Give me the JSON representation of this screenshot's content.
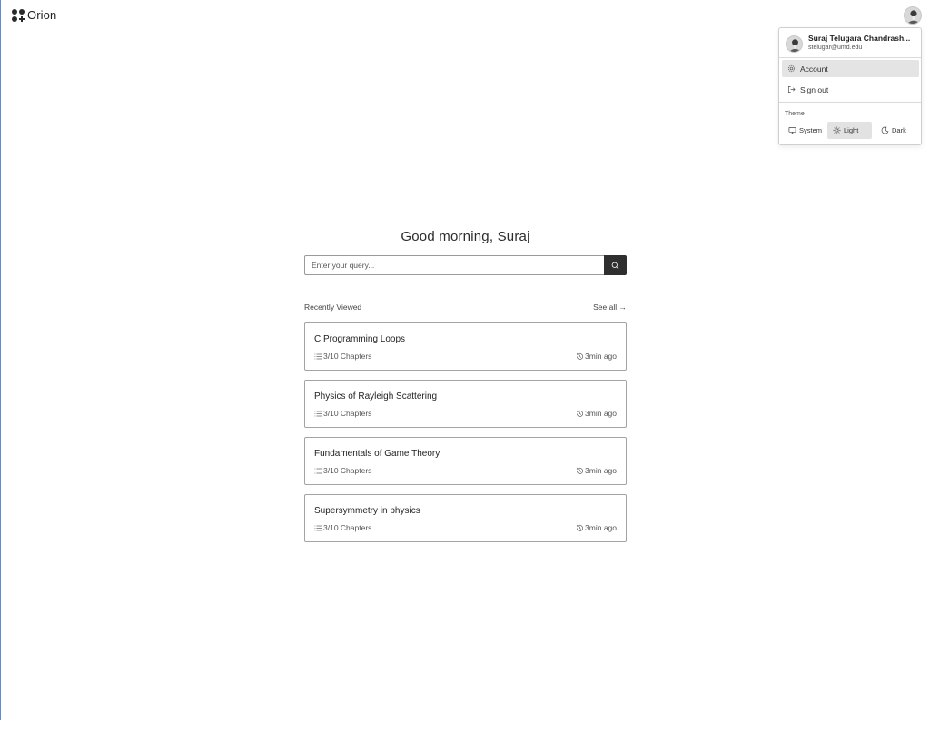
{
  "app": {
    "name": "Orion"
  },
  "user_menu": {
    "name": "Suraj Telugara Chandrash...",
    "email": "stelugar@umd.edu",
    "items": [
      {
        "label": "Account",
        "icon": "gear-icon",
        "active": true
      },
      {
        "label": "Sign out",
        "icon": "sign-out-icon",
        "active": false
      }
    ],
    "theme": {
      "label": "Theme",
      "options": [
        {
          "label": "System",
          "icon": "monitor-icon",
          "active": false
        },
        {
          "label": "Light",
          "icon": "sun-icon",
          "active": true
        },
        {
          "label": "Dark",
          "icon": "moon-icon",
          "active": false
        }
      ]
    }
  },
  "main": {
    "greeting": "Good morning, Suraj",
    "search": {
      "placeholder": "Enter your query..."
    },
    "recent": {
      "heading": "Recently Viewed",
      "see_all": "See all →",
      "items": [
        {
          "title": "C Programming Loops",
          "progress": "3/10 Chapters",
          "time": "3min ago"
        },
        {
          "title": "Physics of Rayleigh Scattering",
          "progress": "3/10 Chapters",
          "time": "3min ago"
        },
        {
          "title": "Fundamentals of Game Theory",
          "progress": "3/10 Chapters",
          "time": "3min ago"
        },
        {
          "title": "Supersymmetry in physics",
          "progress": "3/10 Chapters",
          "time": "3min ago"
        }
      ]
    }
  },
  "colors": {
    "accent_dark": "#2f2f2f",
    "menu_highlight": "#e4e4e4"
  }
}
